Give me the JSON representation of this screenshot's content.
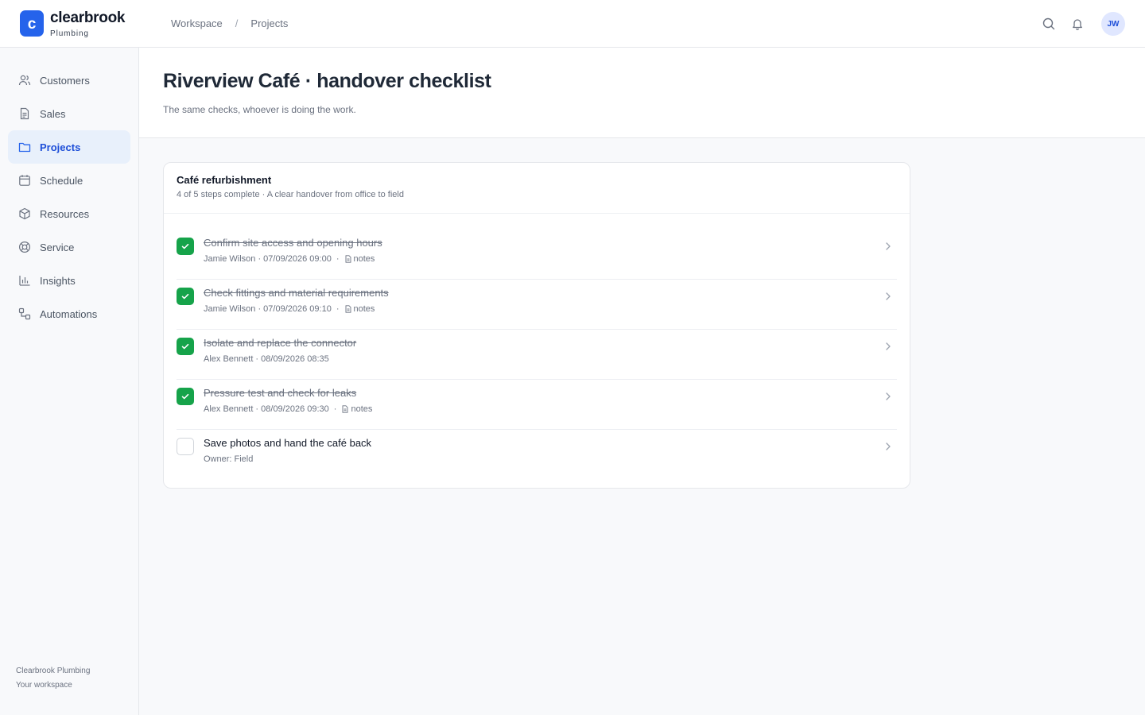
{
  "brand": {
    "mark": "c",
    "name": "clearbrook",
    "sub": "Plumbing"
  },
  "breadcrumb": {
    "items": [
      "Workspace",
      "Projects"
    ],
    "separator": "/"
  },
  "user": {
    "initials": "JW"
  },
  "sidebar": {
    "items": [
      {
        "label": "Customers",
        "icon": "users-icon",
        "active": false
      },
      {
        "label": "Sales",
        "icon": "document-icon",
        "active": false
      },
      {
        "label": "Projects",
        "icon": "folder-icon",
        "active": true
      },
      {
        "label": "Schedule",
        "icon": "calendar-icon",
        "active": false
      },
      {
        "label": "Resources",
        "icon": "box-icon",
        "active": false
      },
      {
        "label": "Service",
        "icon": "lifebuoy-icon",
        "active": false
      },
      {
        "label": "Insights",
        "icon": "bar-chart-icon",
        "active": false
      },
      {
        "label": "Automations",
        "icon": "workflow-icon",
        "active": false
      }
    ],
    "footer": {
      "company": "Clearbrook Plumbing",
      "workspace": "Your workspace"
    }
  },
  "page": {
    "title": "Riverview Café · handover checklist",
    "subtitle": "The same checks, whoever is doing the work."
  },
  "checklist": {
    "title": "Café refurbishment",
    "subtitle": "4 of 5 steps complete · A clear handover from office to field",
    "steps": [
      {
        "label": "Confirm site access and opening hours",
        "done": true,
        "meta": "Jamie Wilson · 07/09/2026 09:00",
        "notes": "notes"
      },
      {
        "label": "Check fittings and material requirements",
        "done": true,
        "meta": "Jamie Wilson · 07/09/2026 09:10",
        "notes": "notes"
      },
      {
        "label": "Isolate and replace the connector",
        "done": true,
        "meta": "Alex Bennett · 08/09/2026 08:35",
        "notes": null
      },
      {
        "label": "Pressure test and check for leaks",
        "done": true,
        "meta": "Alex Bennett · 08/09/2026 09:30",
        "notes": "notes"
      },
      {
        "label": "Save photos and hand the café back",
        "done": false,
        "meta": "Owner: Field",
        "notes": null
      }
    ]
  },
  "colors": {
    "accent": "#2563eb",
    "done": "#16a34a",
    "activeNavBg": "#e8f0fb"
  }
}
